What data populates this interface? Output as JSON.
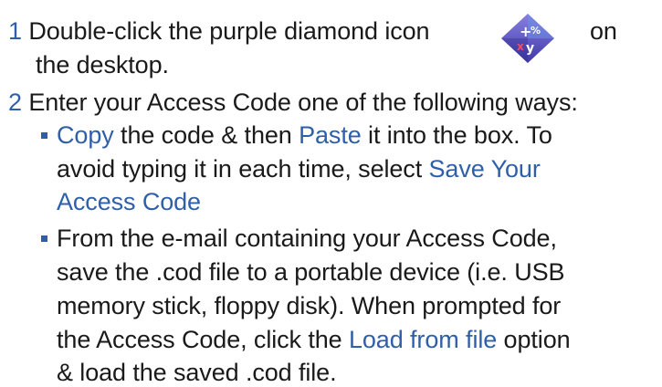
{
  "step1": {
    "number": "1",
    "text_before_icon": "Double-click the purple diamond icon",
    "text_after_icon": "on",
    "text_line2": "the desktop.",
    "icon": "purple-diamond-icon"
  },
  "step2": {
    "number": "2",
    "text": "Enter your Access Code one of the following ways:",
    "bullet1": {
      "link_copy": "Copy",
      "text_mid": " the code & then ",
      "link_paste": "Paste",
      "text_end": " it into the box. To",
      "line2_text": "avoid typing it in each time, select ",
      "link_save_a": "Save Your",
      "link_save_b": "Access Code"
    },
    "bullet2": {
      "line1": "From the e-mail containing your Access Code,",
      "line2": "save the .cod file to a portable device (i.e. USB",
      "line3": "memory stick, floppy disk). When prompted for",
      "line4_before": "the Access Code, click the ",
      "link_load": "Load from file",
      "line4_after": " option",
      "line5": "& load the saved .cod file."
    }
  },
  "colors": {
    "accent": "#2f5fa8",
    "text": "#1a1a1a",
    "icon_purple": "#5a3fb0",
    "icon_blue": "#3d6fd6"
  }
}
